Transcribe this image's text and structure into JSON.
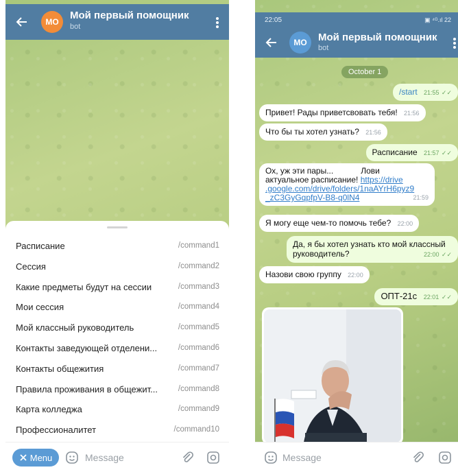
{
  "left": {
    "header": {
      "avatar_initials": "MO",
      "title": "Мой первый помощник",
      "subtitle": "bot"
    },
    "commands": [
      {
        "label": "Расписание",
        "command": "/command1"
      },
      {
        "label": "Сессия",
        "command": "/command2"
      },
      {
        "label": "Какие предметы будут на сессии",
        "command": "/command3"
      },
      {
        "label": "Мои сессия",
        "command": "/command4"
      },
      {
        "label": "Мой классный руководитель",
        "command": "/command5"
      },
      {
        "label": "Контакты заведующей отделени...",
        "command": "/command6"
      },
      {
        "label": "Контакты общежития",
        "command": "/command7"
      },
      {
        "label": "Правила проживания в общежит...",
        "command": "/command8"
      },
      {
        "label": "Карта колледжа",
        "command": "/command9"
      },
      {
        "label": "Профессионалитет",
        "command": "/command10"
      }
    ],
    "bottom": {
      "menu_label": "Menu",
      "message_placeholder": "Message"
    }
  },
  "right": {
    "status": {
      "time": "22:05",
      "icons": "▣ ⁴ᴳ.ıl 22"
    },
    "header": {
      "avatar_initials": "MO",
      "title": "Мой первый помощник",
      "subtitle": "bot"
    },
    "date": "October 1",
    "messages": {
      "m1": {
        "text": "/start",
        "time": "21:55"
      },
      "m2": {
        "text": "Привет! Рады приветсвовать тебя!",
        "time": "21:56"
      },
      "m3": {
        "text": "Что бы ты хотел узнать?",
        "time": "21:56"
      },
      "m4": {
        "text": "Расписание",
        "time": "21:57"
      },
      "m5": {
        "line1": "Ох, уж эти пары...",
        "line1b": "Лови",
        "line2": "актуальное расписание!",
        "url1": "https://drive",
        "url2": ".google.com/drive/folders/1naAYrH6pyz9",
        "url3": "_zC3GyGqpfpV-B8-q0lN4",
        "time": "21:59"
      },
      "m6": {
        "text": "Я могу еще чем-то помочь тебе?",
        "time": "22:00"
      },
      "m7": {
        "line1": "Да, я бы хотел узнать кто мой классный",
        "line2": "руководитель?",
        "time": "22:00"
      },
      "m8": {
        "text": "Назови свою группу",
        "time": "22:00"
      },
      "m9": {
        "text": "ОПТ-21с",
        "time": "22:01"
      }
    },
    "bottom": {
      "message_placeholder": "Message"
    }
  },
  "colors": {
    "header": "#517da2",
    "outgoing_bubble": "#effdde",
    "incoming_bubble": "#ffffff",
    "avatar": "#f28c38",
    "menu_button": "#5b9bd5"
  },
  "icons": [
    "back-arrow-icon",
    "kebab-menu-icon",
    "close-icon",
    "sticker-icon",
    "attach-icon",
    "camera-icon",
    "double-check-icon"
  ]
}
